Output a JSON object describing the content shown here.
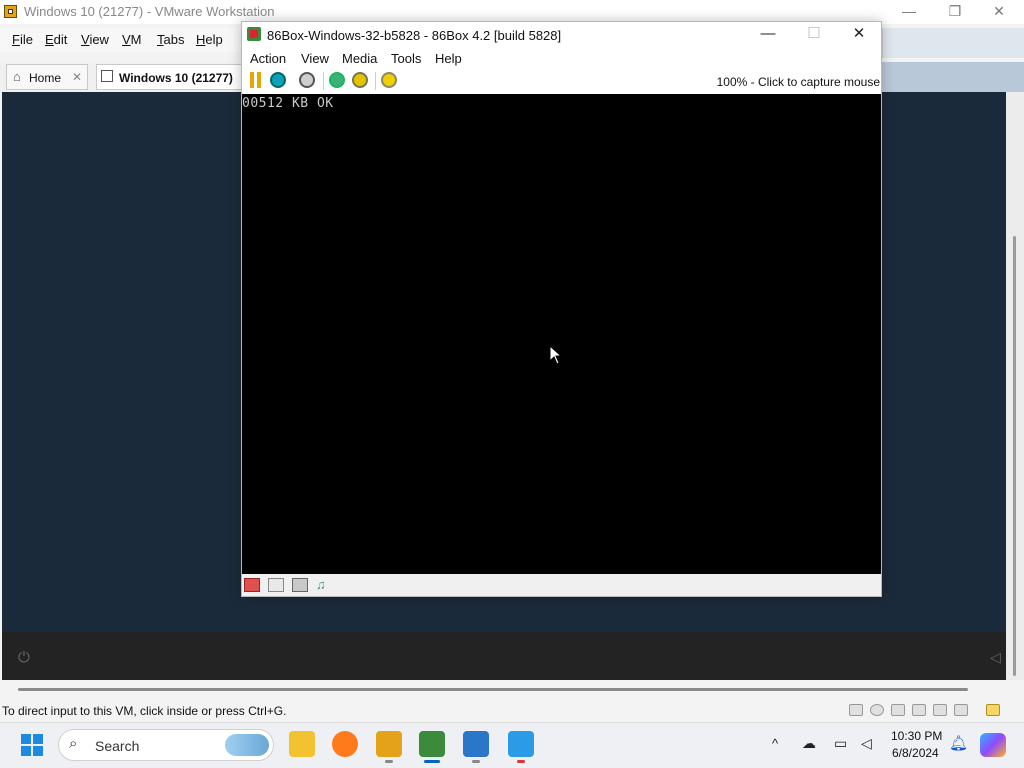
{
  "vmware": {
    "title": "Windows 10 (21277) - VMware Workstation",
    "menu": [
      {
        "key": "F",
        "rest": "ile"
      },
      {
        "key": "E",
        "rest": "dit"
      },
      {
        "key": "V",
        "rest": "iew"
      },
      {
        "key": "V",
        "rest": "M"
      },
      {
        "key": "T",
        "rest": "abs"
      },
      {
        "key": "H",
        "rest": "elp"
      }
    ],
    "tabs": {
      "home": "Home",
      "vm": "Windows 10 (21277)"
    },
    "status_text": "To direct input to this VM, click inside or press Ctrl+G."
  },
  "box86": {
    "title": "86Box-Windows-32-b5828 - 86Box 4.2 [build 5828]",
    "menu": [
      "Action",
      "View",
      "Media",
      "Tools",
      "Help"
    ],
    "capture_hint": "100% - Click to capture mouse",
    "bios_text": "00512 KB OK",
    "toolbar_icons": [
      "pause-icon",
      "hard-reset-icon",
      "ctrl-alt-del-icon",
      "settings-icon",
      "screenshot-icon",
      "machine-config-icon"
    ]
  },
  "taskbar": {
    "search_placeholder": "Search",
    "time": "10:30 PM",
    "date": "6/8/2024",
    "apps": [
      "file-explorer-icon",
      "firefox-icon",
      "vmware-icon",
      "86box-icon",
      "sandbox-icon",
      "paint-icon"
    ]
  },
  "colors": {
    "vm_background": "#1b2a3a",
    "accent": "#0067c0",
    "box_screen": "#000000"
  }
}
